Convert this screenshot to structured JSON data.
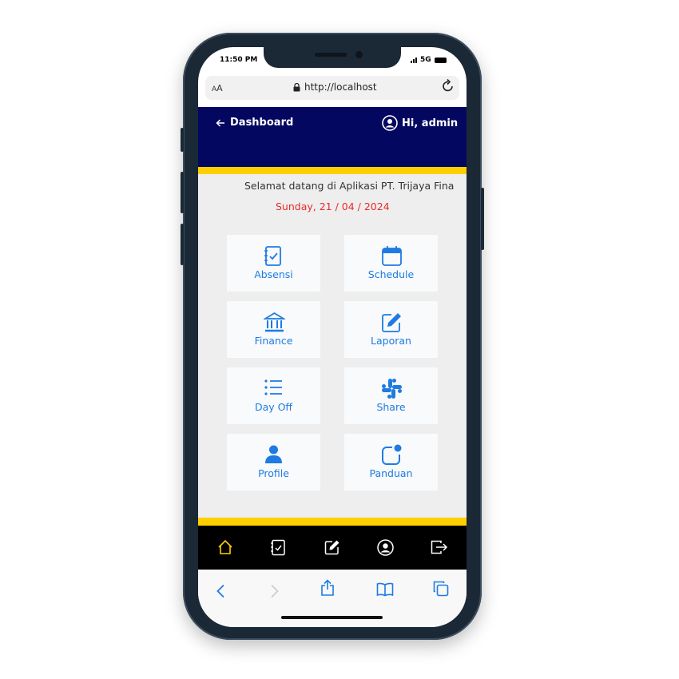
{
  "status": {
    "time": "11:50 PM",
    "network": "5G"
  },
  "browser": {
    "text_size_label_small": "A",
    "text_size_label_large": "A",
    "url": "http://localhost"
  },
  "header": {
    "back_label": "Dashboard",
    "greeting": "Hi, admin"
  },
  "main": {
    "welcome": "Selamat datang di Aplikasi PT. Trijaya Fina",
    "date": "Sunday, 21 / 04 / 2024",
    "menu": [
      {
        "label": "Absensi",
        "icon": "checklist-icon"
      },
      {
        "label": "Schedule",
        "icon": "calendar-icon"
      },
      {
        "label": "Finance",
        "icon": "bank-icon"
      },
      {
        "label": "Laporan",
        "icon": "edit-icon"
      },
      {
        "label": "Day Off",
        "icon": "list-icon"
      },
      {
        "label": "Share",
        "icon": "slack-icon"
      },
      {
        "label": "Profile",
        "icon": "person-icon"
      },
      {
        "label": "Panduan",
        "icon": "notification-icon"
      }
    ]
  },
  "bottom_nav": [
    "home-icon",
    "checklist-icon",
    "edit-icon",
    "account-icon",
    "logout-icon"
  ],
  "colors": {
    "header": "#040760",
    "accent": "#ffcf00",
    "tile_text": "#1e7be2",
    "date": "#ea2a2a",
    "active_tab": "#ffcf00"
  }
}
